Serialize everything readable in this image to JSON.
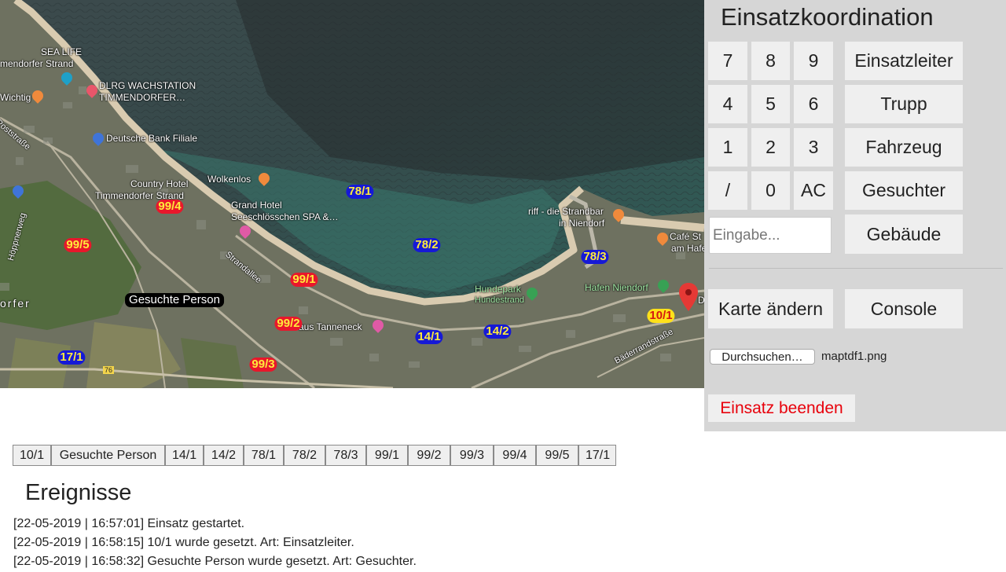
{
  "map": {
    "labels": {
      "sea_life": "SEA LIFE",
      "timmendorfer_strand_top": "mendorfer Strand",
      "dlrg": "DLRG WACHSTATION",
      "dlrg2": "TIMMENDORFER…",
      "wichtig": "Wichtig",
      "deutsche_bank": "Deutsche Bank Filiale",
      "country_hotel": "Country Hotel",
      "country_hotel2": "Timmendorfer Strand",
      "wolkenlos": "Wolkenlos",
      "grand_hotel": "Grand Hotel",
      "grand_hotel2": "Seeschlösschen SPA &…",
      "riff": "riff - die Strandbar",
      "riff2": "in Niendorf",
      "cafe": "Café St",
      "cafe2": "am Hafe",
      "hundepark": "Hundepark",
      "hundestrand": "Hundestrand",
      "hafen": "Hafen Niendorf",
      "haus_tanneneck": "aus Tanneneck",
      "poststrasse": "Poststraße",
      "strandallee": "Strandallee",
      "baederrandstrasse": "Bäderrandstraße",
      "hoppnerweg": "Höppnerweg",
      "dorfer": "orfer",
      "num76": "76",
      "d_edge": "D"
    },
    "markers": {
      "m78_1": "78/1",
      "m78_2": "78/2",
      "m78_3": "78/3",
      "m99_4": "99/4",
      "m99_5": "99/5",
      "m99_1": "99/1",
      "m99_2": "99/2",
      "m99_3": "99/3",
      "m14_1": "14/1",
      "m14_2": "14/2",
      "m17_1": "17/1",
      "m10_1": "10/1",
      "gesuchte": "Gesuchte Person"
    }
  },
  "panel": {
    "title": "Einsatzkoordination",
    "keypad": [
      "7",
      "8",
      "9",
      "4",
      "5",
      "6",
      "1",
      "2",
      "3",
      "/",
      "0",
      "AC"
    ],
    "types": [
      "Einsatzleiter",
      "Trupp",
      "Fahrzeug",
      "Gesuchter",
      "Gebäude"
    ],
    "input_placeholder": "Eingabe...",
    "map_change": "Karte ändern",
    "console": "Console",
    "file_button": "Durchsuchen…",
    "file_name": "maptdf1.png",
    "end": "Einsatz beenden"
  },
  "unit_tabs": [
    "10/1",
    "Gesuchte Person",
    "14/1",
    "14/2",
    "78/1",
    "78/2",
    "78/3",
    "99/1",
    "99/2",
    "99/3",
    "99/4",
    "99/5",
    "17/1"
  ],
  "events": {
    "title": "Ereignisse",
    "items": [
      "[22-05-2019 | 16:57:01] Einsatz gestartet.",
      "[22-05-2019 | 16:58:15] 10/1 wurde gesetzt. Art: Einsatzleiter.",
      "[22-05-2019 | 16:58:32] Gesuchte Person wurde gesetzt. Art: Gesuchter."
    ]
  },
  "colors": {
    "marker_red": "#e8172b",
    "marker_blue": "#1619d6",
    "marker_yellow": "#ffe11a",
    "end_text": "#e8000b",
    "panel_bg": "#d6d6d6"
  }
}
